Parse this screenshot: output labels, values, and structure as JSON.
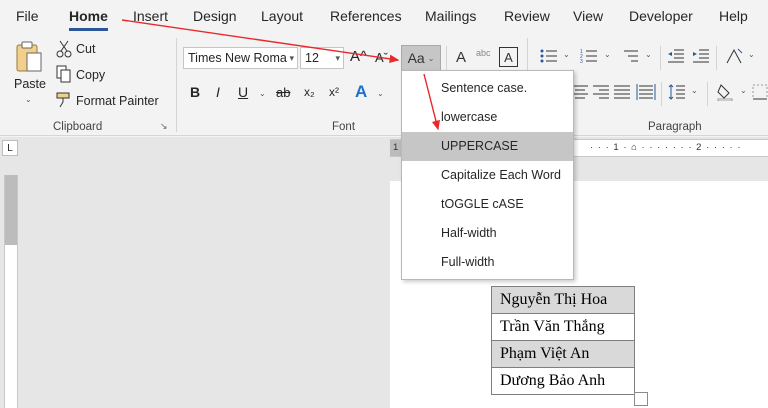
{
  "tabs": [
    "File",
    "Home",
    "Insert",
    "Design",
    "Layout",
    "References",
    "Mailings",
    "Review",
    "View",
    "Developer",
    "Help"
  ],
  "active_tab": "Home",
  "clipboard": {
    "paste": "Paste",
    "cut": "Cut",
    "copy": "Copy",
    "format_painter": "Format Painter",
    "group_label": "Clipboard"
  },
  "font": {
    "family": "Times New Roma",
    "size": "12",
    "grow": "A^",
    "shrink": "Aˇ",
    "change_case": "Aa",
    "bold": "B",
    "italic": "I",
    "underline": "U",
    "strike": "ab",
    "subscript": "x₂",
    "superscript": "x²",
    "text_effects": "A",
    "clear_format": "A",
    "phonetic": "abc",
    "char_border": "A",
    "group_label": "Font"
  },
  "paragraph": {
    "group_label": "Paragraph"
  },
  "ruler": {
    "corner": "L",
    "marks": [
      "1",
      "1",
      "2"
    ]
  },
  "case_menu": {
    "items": [
      "Sentence case.",
      "lowercase",
      "UPPERCASE",
      "Capitalize Each Word",
      "tOGGLE cASE",
      "Half-width",
      "Full-width"
    ],
    "selected": "UPPERCASE"
  },
  "table": {
    "names": [
      "Nguyễn Thị Hoa",
      "Trần Văn Thắng",
      "Phạm Việt An",
      "Dương Bảo Anh"
    ]
  },
  "colors": {
    "accent": "#2b579a",
    "arrow": "#e8292c",
    "selected_item": "#c6c6c6"
  }
}
